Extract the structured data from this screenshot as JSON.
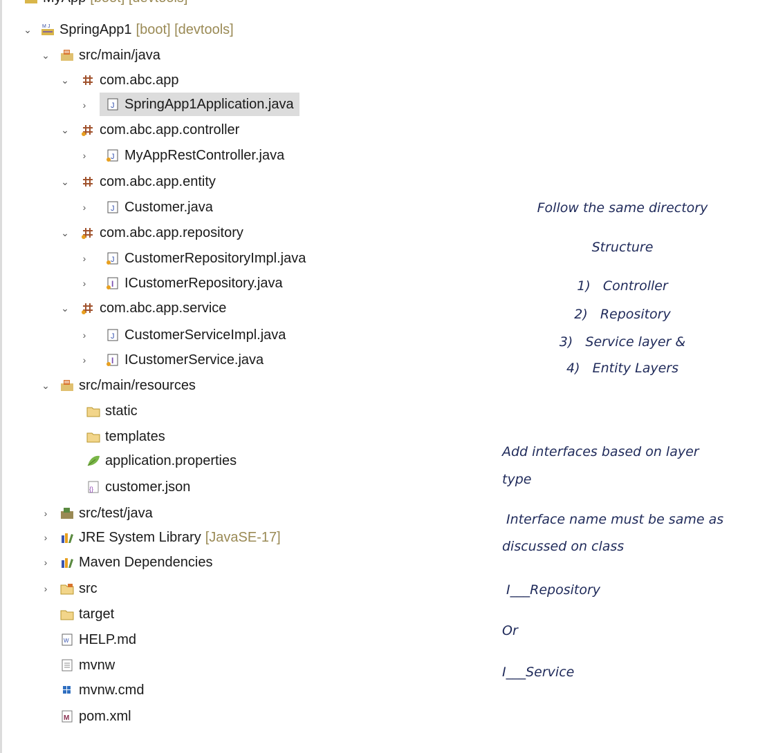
{
  "tree": {
    "items": [
      {
        "label": "MyApp",
        "decoration": "[boot] [devtools]",
        "icon": "project-icon",
        "toggle": "expanded"
      },
      {
        "label": "SpringApp1",
        "decoration": "[boot] [devtools]",
        "icon": "spring-project-icon",
        "toggle": "expanded"
      },
      {
        "label": "src/main/java",
        "decoration": "",
        "icon": "source-folder-icon",
        "toggle": "expanded"
      },
      {
        "label": "com.abc.app",
        "decoration": "",
        "icon": "package-icon",
        "toggle": "expanded"
      },
      {
        "label": "SpringApp1Application.java",
        "decoration": "",
        "icon": "java-class-icon",
        "toggle": "collapsed",
        "selected": true
      },
      {
        "label": "com.abc.app.controller",
        "decoration": "",
        "icon": "package-icon",
        "toggle": "expanded"
      },
      {
        "label": "MyAppRestController.java",
        "decoration": "",
        "icon": "java-class-icon",
        "toggle": "collapsed"
      },
      {
        "label": "com.abc.app.entity",
        "decoration": "",
        "icon": "package-icon",
        "toggle": "expanded"
      },
      {
        "label": "Customer.java",
        "decoration": "",
        "icon": "java-class-icon",
        "toggle": "collapsed"
      },
      {
        "label": "com.abc.app.repository",
        "decoration": "",
        "icon": "package-icon",
        "toggle": "expanded"
      },
      {
        "label": "CustomerRepositoryImpl.java",
        "decoration": "",
        "icon": "java-class-icon",
        "toggle": "collapsed"
      },
      {
        "label": "ICustomerRepository.java",
        "decoration": "",
        "icon": "java-interface-icon",
        "toggle": "collapsed"
      },
      {
        "label": "com.abc.app.service",
        "decoration": "",
        "icon": "package-icon",
        "toggle": "expanded"
      },
      {
        "label": "CustomerServiceImpl.java",
        "decoration": "",
        "icon": "java-class-icon",
        "toggle": "collapsed"
      },
      {
        "label": "ICustomerService.java",
        "decoration": "",
        "icon": "java-interface-icon",
        "toggle": "collapsed"
      },
      {
        "label": "src/main/resources",
        "decoration": "",
        "icon": "source-folder-icon",
        "toggle": "expanded"
      },
      {
        "label": "static",
        "decoration": "",
        "icon": "folder-icon",
        "toggle": "none"
      },
      {
        "label": "templates",
        "decoration": "",
        "icon": "folder-icon",
        "toggle": "none"
      },
      {
        "label": "application.properties",
        "decoration": "",
        "icon": "properties-leaf-icon",
        "toggle": "none"
      },
      {
        "label": "customer.json",
        "decoration": "",
        "icon": "json-file-icon",
        "toggle": "none"
      },
      {
        "label": "src/test/java",
        "decoration": "",
        "icon": "source-folder-icon",
        "toggle": "collapsed"
      },
      {
        "label": "JRE System Library",
        "decoration": "[JavaSE-17]",
        "icon": "library-icon",
        "toggle": "collapsed"
      },
      {
        "label": "Maven Dependencies",
        "decoration": "",
        "icon": "library-icon",
        "toggle": "collapsed"
      },
      {
        "label": "src",
        "decoration": "",
        "icon": "folder-icon",
        "toggle": "collapsed"
      },
      {
        "label": "target",
        "decoration": "",
        "icon": "folder-icon",
        "toggle": "none"
      },
      {
        "label": "HELP.md",
        "decoration": "",
        "icon": "markdown-file-icon",
        "toggle": "none"
      },
      {
        "label": "mvnw",
        "decoration": "",
        "icon": "text-file-icon",
        "toggle": "none"
      },
      {
        "label": "mvnw.cmd",
        "decoration": "",
        "icon": "cmd-file-icon",
        "toggle": "none"
      },
      {
        "label": "pom.xml",
        "decoration": "",
        "icon": "maven-pom-icon",
        "toggle": "none"
      }
    ]
  },
  "notes": {
    "line1": "Follow the same directory",
    "line2": "Structure",
    "list": [
      "1)   Controller",
      "2)   Repository",
      "3)   Service layer &",
      "4)   Entity Layers"
    ],
    "add_interfaces_1": "Add interfaces based on layer",
    "add_interfaces_2": "type",
    "interface_name_1": " Interface name must be same as",
    "interface_name_2": "discussed on class",
    "pattern_repo": " I___Repository",
    "or": "Or",
    "pattern_service": "I___Service"
  },
  "colors": {
    "selection": "#dcdcdc",
    "decoration": "#9a8a55",
    "note_text": "#1f2a5a"
  }
}
